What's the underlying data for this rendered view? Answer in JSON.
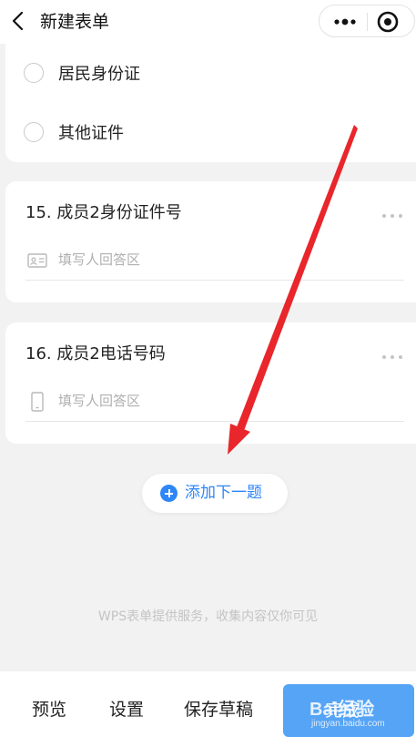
{
  "nav": {
    "title": "新建表单",
    "back_icon": "chevron-left-icon",
    "more_icon": "more-dots-icon",
    "target_icon": "target-icon"
  },
  "question_14": {
    "options": [
      {
        "label": "居民身份证"
      },
      {
        "label": "其他证件"
      }
    ]
  },
  "questions": [
    {
      "title": "15. 成员2身份证件号",
      "placeholder": "填写人回答区",
      "answer_icon": "id-card-icon"
    },
    {
      "title": "16. 成员2电话号码",
      "placeholder": "填写人回答区",
      "answer_icon": "phone-icon"
    }
  ],
  "add_next": {
    "label": "添加下一题"
  },
  "footer_note": "WPS表单提供服务，收集内容仅你可见",
  "bottom_bar": {
    "preview": "预览",
    "settings": "设置",
    "save_draft": "保存草稿",
    "done": "完成"
  },
  "watermark": {
    "logo": "Bai经验",
    "sub": "jingyan.baidu.com"
  },
  "colors": {
    "accent": "#2f86f6",
    "done_button": "#55a4f5",
    "page_bg": "#f2f2f2",
    "annotation_arrow": "#e8262b"
  }
}
